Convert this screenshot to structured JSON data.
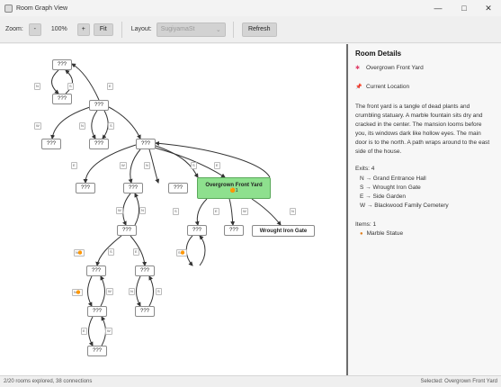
{
  "window": {
    "title": "Room Graph View",
    "minimize_glyph": "—",
    "maximize_glyph": "□",
    "close_glyph": "✕"
  },
  "toolbar": {
    "zoom_label": "Zoom:",
    "zoom_out": "-",
    "zoom_value": "100%",
    "zoom_in": "+",
    "fit": "Fit",
    "layout_label": "Layout:",
    "layout_value": "SugiyamaSt",
    "refresh": "Refresh"
  },
  "graph": {
    "unknown_label": "???",
    "selected_room": {
      "name": "Overgrown Front Yard",
      "item_marker": "🟠1"
    },
    "named_room": "Wrought Iron Gate",
    "edge_labels": [
      "N",
      "S",
      "E",
      "W",
      "N",
      "S",
      "E",
      "W",
      "N",
      "S",
      "E",
      "W",
      "N",
      "S",
      "E",
      "W",
      "N",
      "S",
      "E",
      "W",
      "N",
      "S",
      "E",
      "W"
    ],
    "item_markers": [
      "N🟠",
      "S🟠",
      "N🟠"
    ]
  },
  "details": {
    "heading": "Room Details",
    "room_name": "Overgrown Front Yard",
    "location_label": "Current Location",
    "description": "The front yard is a tangle of dead plants and crumbling statuary. A marble fountain sits dry and cracked in the center. The mansion looms before you, its windows dark like hollow eyes. The main door is to the north. A path wraps around to the east side of the house.",
    "exits_heading": "Exits: 4",
    "exits": [
      "N → Grand Entrance Hall",
      "S → Wrought Iron Gate",
      "E → Side Garden",
      "W → Blackwood Family Cemetery"
    ],
    "items_heading": "Items: 1",
    "items": [
      "Marble Statue"
    ]
  },
  "status": {
    "left": "2/20 rooms explored, 38 connections",
    "right": "Selected: Overgrown Front Yard"
  },
  "colors": {
    "selected_node": "#8ee08e",
    "splitter": "#6d6d6d"
  }
}
